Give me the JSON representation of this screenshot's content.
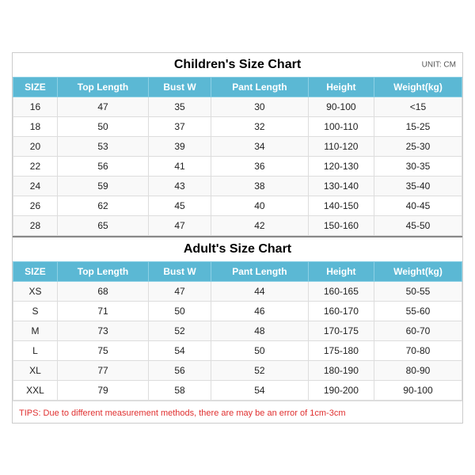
{
  "children_section": {
    "title": "Children's Size Chart",
    "unit": "UNIT: CM",
    "headers": [
      "SIZE",
      "Top Length",
      "Bust W",
      "Pant Length",
      "Height",
      "Weight(kg)"
    ],
    "rows": [
      [
        "16",
        "47",
        "35",
        "30",
        "90-100",
        "<15"
      ],
      [
        "18",
        "50",
        "37",
        "32",
        "100-110",
        "15-25"
      ],
      [
        "20",
        "53",
        "39",
        "34",
        "110-120",
        "25-30"
      ],
      [
        "22",
        "56",
        "41",
        "36",
        "120-130",
        "30-35"
      ],
      [
        "24",
        "59",
        "43",
        "38",
        "130-140",
        "35-40"
      ],
      [
        "26",
        "62",
        "45",
        "40",
        "140-150",
        "40-45"
      ],
      [
        "28",
        "65",
        "47",
        "42",
        "150-160",
        "45-50"
      ]
    ]
  },
  "adult_section": {
    "title": "Adult's Size Chart",
    "headers": [
      "SIZE",
      "Top Length",
      "Bust W",
      "Pant Length",
      "Height",
      "Weight(kg)"
    ],
    "rows": [
      [
        "XS",
        "68",
        "47",
        "44",
        "160-165",
        "50-55"
      ],
      [
        "S",
        "71",
        "50",
        "46",
        "160-170",
        "55-60"
      ],
      [
        "M",
        "73",
        "52",
        "48",
        "170-175",
        "60-70"
      ],
      [
        "L",
        "75",
        "54",
        "50",
        "175-180",
        "70-80"
      ],
      [
        "XL",
        "77",
        "56",
        "52",
        "180-190",
        "80-90"
      ],
      [
        "XXL",
        "79",
        "58",
        "54",
        "190-200",
        "90-100"
      ]
    ]
  },
  "tips": {
    "text": "TIPS: Due to different measurement methods, there are may be an error of 1cm-3cm"
  }
}
